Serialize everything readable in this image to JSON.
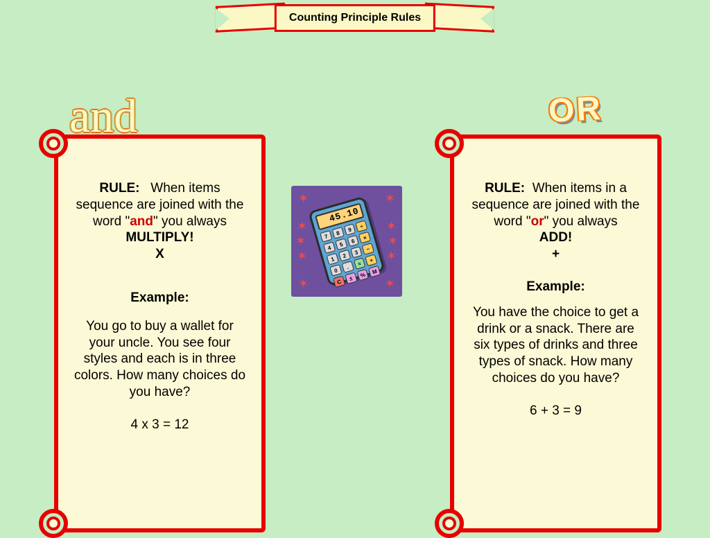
{
  "title": "Counting Principle Rules",
  "headings": {
    "and": "and",
    "or": "OR"
  },
  "left": {
    "rule_label": "RULE:",
    "rule_line1": "When items sequence are joined with the word \"",
    "rule_keyword": "and",
    "rule_line2": "\" you always",
    "rule_emph": "MULTIPLY!",
    "rule_sym": "X",
    "example_label": "Example:",
    "example_body": "You go to buy a wallet for your uncle. You see four styles and each is in three colors. How many choices do you have?",
    "compute": "4 x 3 = 12"
  },
  "right": {
    "rule_label": "RULE:",
    "rule_line1": "When items in a sequence are joined with the word \"",
    "rule_keyword": "or",
    "rule_line2": "\" you always",
    "rule_emph": "ADD!",
    "rule_sym": "+",
    "example_label": "Example:",
    "example_body": "You have the choice to get a drink or a snack. There are six types of drinks and three types of snack. How many choices do you have?",
    "compute": "6 + 3 = 9"
  },
  "calculator": {
    "display": "45.10",
    "keys": [
      "7",
      "8",
      "9",
      "÷",
      "4",
      "5",
      "6",
      "×",
      "1",
      "2",
      "3",
      "−",
      "0",
      ".",
      "=",
      "+",
      "C",
      "±",
      "%",
      "M"
    ]
  }
}
